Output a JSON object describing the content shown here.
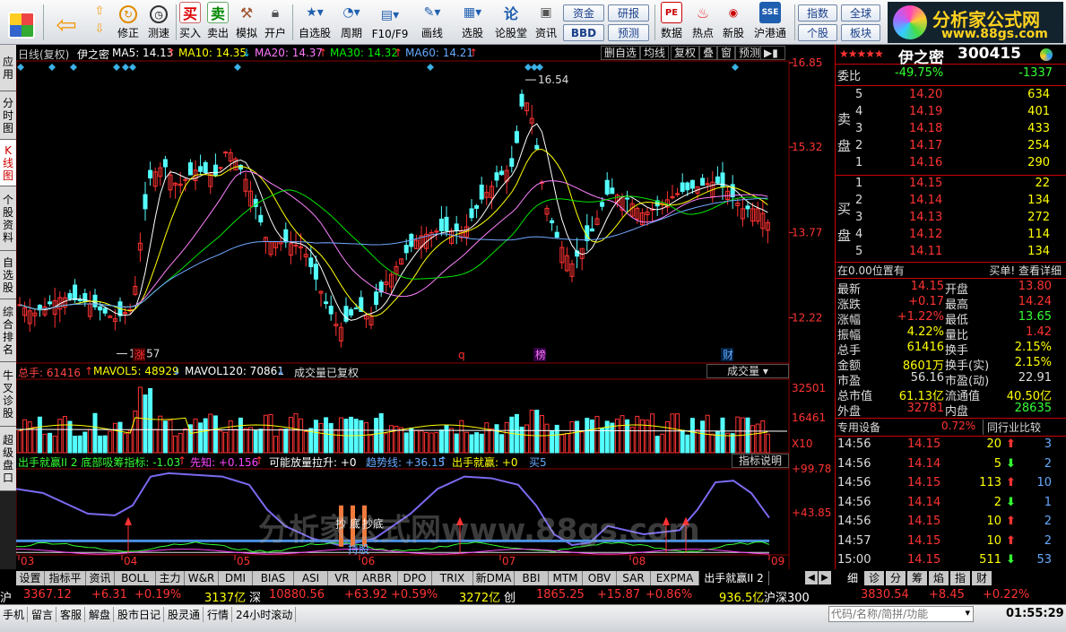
{
  "toolbar": {
    "buttons": [
      "修正",
      "测速",
      "买入",
      "卖出",
      "模拟",
      "开户",
      "自选股",
      "周期",
      "F10/F9",
      "画线",
      "选股",
      "论股堂",
      "资讯",
      "数据",
      "热点",
      "新股",
      "沪港通"
    ],
    "boxes": [
      "资金",
      "研报",
      "BBD",
      "预测",
      "指数",
      "全球",
      "个股",
      "板块"
    ],
    "logo_title": "分析家公式网",
    "logo_url": "www.88gs.com"
  },
  "sidebar": [
    "应用",
    "分时图",
    "K线图",
    "个股资料",
    "自选股",
    "综合排名",
    "牛叉诊股",
    "超级盘口"
  ],
  "infobar": {
    "title": "日线(复权)",
    "stock": "伊之密",
    "ma5": "MA5: 14.13",
    "ma10": "MA10: 14.35",
    "ma20": "MA20: 14.37",
    "ma30": "MA30: 14.32",
    "ma60": "MA60: 14.21",
    "btns": [
      "删自选",
      "均线",
      "复权",
      "叠",
      "窗",
      "预测"
    ]
  },
  "price_axis": [
    "16.85",
    "15.32",
    "13.77",
    "12.22"
  ],
  "vol_axis": [
    "32501",
    "16461",
    "X10"
  ],
  "ind_axis": [
    "+99.78",
    "+43.85"
  ],
  "x_axis": [
    "03",
    "04",
    "05",
    "06",
    "07",
    "08",
    "09"
  ],
  "annotations": {
    "high": "16.54",
    "low": "11.57",
    "m1": "涨",
    "m2": "q",
    "m3": "榜",
    "m4": "财",
    "ind1": "抄",
    "ind2": "底",
    "ind3": "抄底",
    "ind4": "持股"
  },
  "volbar": {
    "total": "总手: 61416",
    "mavol5": "MAVOL5: 48929",
    "mavol120": "MAVOL120: 70861",
    "note": "成交量已复权",
    "select": "成交量"
  },
  "indbar": {
    "name": "出手就赢II 2 底部吸筹指标: -1.03",
    "xz": "先知: +0.156",
    "fl": "可能放量拉升: +0",
    "qs": "趋势线: +36.15",
    "cs": "出手就赢: +0",
    "mm": "买5",
    "help": "指标说明"
  },
  "watermark": "分析家公式网www.88gs.com",
  "chart_data": {
    "type": "candlestick",
    "x": [
      "03",
      "04",
      "05",
      "06",
      "07",
      "08",
      "09"
    ],
    "price_ylim": [
      11.4,
      16.85
    ],
    "price_ticks": [
      16.85,
      15.32,
      13.77,
      12.22
    ],
    "vol_ticks": [
      32501,
      16461
    ],
    "ind_ticks": [
      99.78,
      43.85
    ],
    "high": 16.54,
    "low": 11.57,
    "ma": {
      "MA5": 14.13,
      "MA10": 14.35,
      "MA20": 14.37,
      "MA30": 14.32,
      "MA60": 14.21
    },
    "colors": {
      "up": "#ff3232",
      "down": "#54ffff",
      "ma5": "#ffffff",
      "ma10": "#ffff00",
      "ma20": "#ff80ff",
      "ma30": "#00e600",
      "ma60": "#6fa8ff"
    }
  },
  "quote": {
    "name": "伊之密",
    "code": "300415",
    "weibi_label": "委比",
    "weibi": "-49.75%",
    "weicha": "-1337",
    "sell_label": "卖盘",
    "buy_label": "买盘",
    "sells": [
      [
        "5",
        "14.20",
        "634"
      ],
      [
        "4",
        "14.19",
        "401"
      ],
      [
        "3",
        "14.18",
        "433"
      ],
      [
        "2",
        "14.17",
        "254"
      ],
      [
        "1",
        "14.16",
        "290"
      ]
    ],
    "buys": [
      [
        "1",
        "14.15",
        "22"
      ],
      [
        "2",
        "14.14",
        "134"
      ],
      [
        "3",
        "14.13",
        "272"
      ],
      [
        "4",
        "14.12",
        "114"
      ],
      [
        "5",
        "14.11",
        "134"
      ]
    ],
    "pos_note": "在0.00位置有",
    "pos_right": "买单! 查看详细",
    "stats": [
      [
        "最新",
        "14.15",
        "开盘",
        "13.80"
      ],
      [
        "涨跌",
        "+0.17",
        "最高",
        "14.24"
      ],
      [
        "涨幅",
        "+1.22%",
        "最低",
        "13.65"
      ],
      [
        "振幅",
        "4.22%",
        "量比",
        "1.42"
      ],
      [
        "总手",
        "61416",
        "换手",
        "2.15%"
      ],
      [
        "金额",
        "8601万",
        "换手(实)",
        "2.15%"
      ],
      [
        "市盈",
        "56.16",
        "市盈(动)",
        "22.91"
      ],
      [
        "总市值",
        "61.13亿",
        "流通值",
        "40.50亿"
      ],
      [
        "外盘",
        "32781",
        "内盘",
        "28635"
      ]
    ],
    "sp_label": "专用设备",
    "sp_pct": "0.72%",
    "sp_cmp": "同行业比较",
    "trades": [
      [
        "14:56",
        "14.15",
        "20",
        "up",
        "3"
      ],
      [
        "14:56",
        "14.14",
        "5",
        "down",
        "2"
      ],
      [
        "14:56",
        "14.15",
        "113",
        "up",
        "10"
      ],
      [
        "14:56",
        "14.14",
        "2",
        "down",
        "1"
      ],
      [
        "14:56",
        "14.15",
        "10",
        "up",
        "2"
      ],
      [
        "14:57",
        "14.15",
        "10",
        "up",
        "2"
      ],
      [
        "15:00",
        "14.15",
        "511",
        "down",
        "53"
      ]
    ],
    "rtabs": [
      "细",
      "诊",
      "分",
      "筹",
      "焰",
      "指",
      "财"
    ]
  },
  "tabs": [
    "设置",
    "指标平台",
    "资讯",
    "BOLL",
    "主力",
    "W&R",
    "DMI",
    "BIAS",
    "ASI",
    "VR",
    "ARBR",
    "DPO",
    "TRIX",
    "新DMA",
    "BBI",
    "MTM",
    "OBV",
    "SAR",
    "EXPMA",
    "出手就赢II 2"
  ],
  "ticker": {
    "sh": "沪",
    "sh_val": "3367.12",
    "sh_chg": "+6.31",
    "sh_pct": "+0.19%",
    "sh_amt": "3137亿",
    "sz": "深",
    "sz_val": "10880.56",
    "sz_chg": "+63.92",
    "sz_pct": "+0.59%",
    "sz_amt": "3272亿",
    "cy": "创",
    "cy_val": "1865.25",
    "cy_chg": "+15.87",
    "cy_pct": "+0.86%",
    "hs_amt": "936.5亿",
    "hs": "沪深300",
    "hs_val": "3830.54",
    "hs_chg": "+8.45",
    "hs_pct": "+0.22%"
  },
  "status": {
    "items": [
      "手机",
      "留言",
      "客服",
      "解盘",
      "股市日记",
      "股灵通",
      "行情",
      "24小时滚动"
    ],
    "search_placeholder": "代码/名称/简拼/功能",
    "time": "01:55:29"
  }
}
